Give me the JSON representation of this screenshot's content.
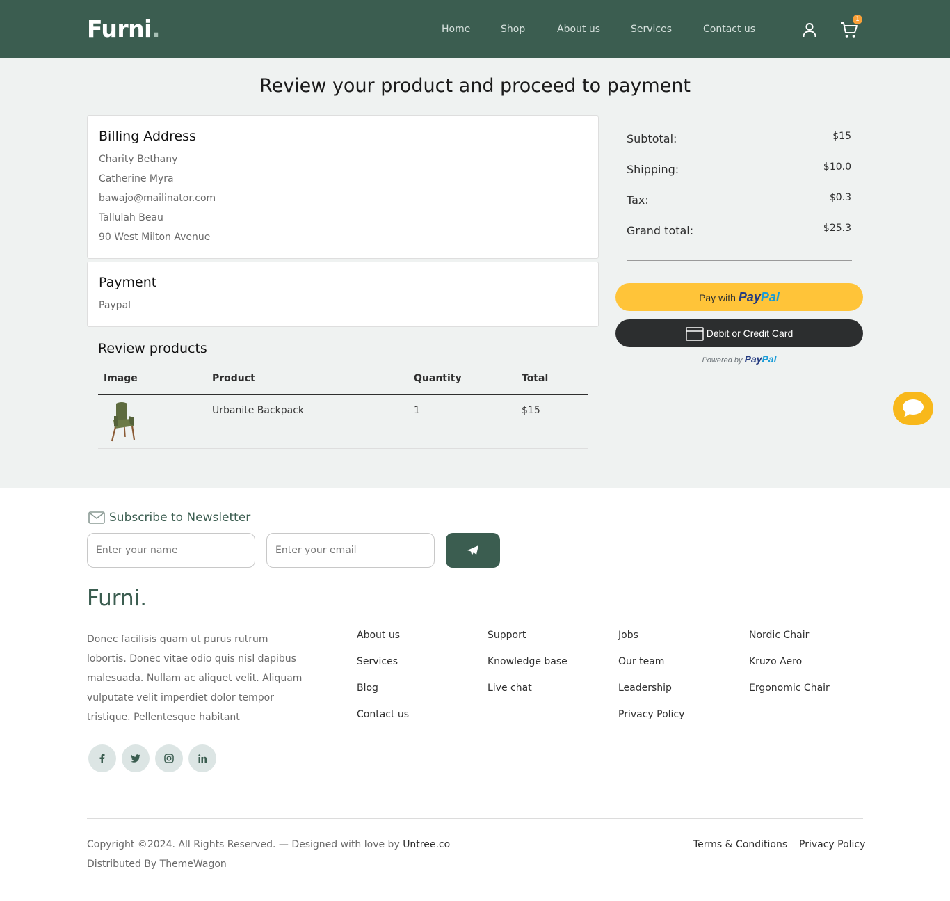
{
  "header": {
    "logo": "Furni",
    "logo_dot": ".",
    "nav": [
      "Home",
      "Shop",
      "About us",
      "Services",
      "Contact us"
    ],
    "cart_count": "1",
    "icons": [
      "user-icon",
      "cart-icon"
    ],
    "colors": {
      "primary": "#3b5d50",
      "badge": "#f9a038"
    }
  },
  "main": {
    "title": "Review your product and proceed to payment",
    "billing": {
      "heading": "Billing Address",
      "lines": [
        "Charity Bethany",
        "Catherine Myra",
        "bawajo@mailinator.com",
        "Tallulah Beau",
        "90 West Milton Avenue"
      ]
    },
    "payment": {
      "heading": "Payment",
      "method": "Paypal"
    },
    "review": {
      "heading": "Review products",
      "columns": [
        "Image",
        "Product",
        "Quantity",
        "Total"
      ],
      "rows": [
        {
          "product": "Urbanite Backpack",
          "quantity": "1",
          "total": "$15"
        }
      ]
    },
    "summary": {
      "subtotal_label": "Subtotal:",
      "subtotal": "$15",
      "shipping_label": "Shipping:",
      "shipping": "$10.0",
      "tax_label": "Tax:",
      "tax": "$0.3",
      "grand_label": "Grand total:",
      "grand": "$25.3"
    },
    "paypal": {
      "pay_with": "Pay with",
      "brand_a": "Pay",
      "brand_b": "Pal",
      "card_label": "Debit or Credit Card",
      "powered_by": "Powered by"
    },
    "chat_icon": "chat-bubble-icon"
  },
  "footer": {
    "newsletter_title": "Subscribe to Newsletter",
    "name_placeholder": "Enter your name",
    "email_placeholder": "Enter your email",
    "logo": "Furni.",
    "about": "Donec facilisis quam ut purus rutrum lobortis. Donec vitae odio quis nisl dapibus malesuada. Nullam ac aliquet velit. Aliquam vulputate velit imperdiet dolor tempor tristique. Pellentesque habitant",
    "social_icons": [
      "facebook-icon",
      "twitter-icon",
      "instagram-icon",
      "linkedin-icon"
    ],
    "col1": [
      "About us",
      "Services",
      "Blog",
      "Contact us"
    ],
    "col2": [
      "Support",
      "Knowledge base",
      "Live chat"
    ],
    "col3": [
      "Jobs",
      "Our team",
      "Leadership",
      "Privacy Policy"
    ],
    "col4": [
      "Nordic Chair",
      "Kruzo Aero",
      "Ergonomic Chair"
    ],
    "copyright": "Copyright ©2024. All Rights Reserved. — Designed with love by ",
    "designer": "Untree.co",
    "distributed": "Distributed By ThemeWagon",
    "terms": "Terms & Conditions",
    "privacy": "Privacy Policy"
  }
}
